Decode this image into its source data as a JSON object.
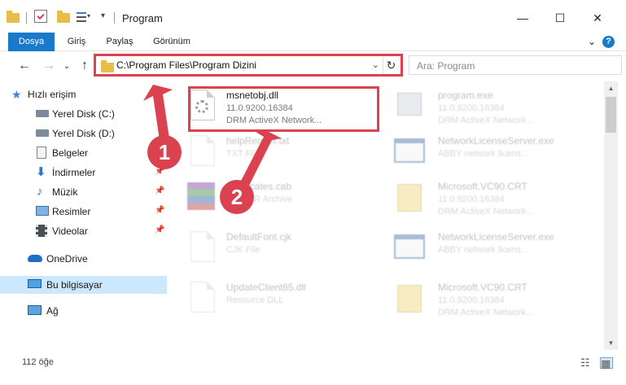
{
  "window": {
    "title": "Program",
    "minimize": "—",
    "maximize": "☐",
    "close": "✕"
  },
  "ribbon": {
    "tabs": [
      "Dosya",
      "Giriş",
      "Paylaş",
      "Görünüm"
    ],
    "expand": "⌄",
    "help": "?"
  },
  "address": {
    "back": "←",
    "forward": "→",
    "recent": "⌄",
    "up": "↑",
    "path": "C:\\Program Files\\Program Dizini",
    "dropdown": "⌄",
    "refresh": "↻",
    "search_placeholder": "Ara: Program"
  },
  "sidebar": {
    "items": [
      {
        "label": "Hızlı erişim",
        "icon": "star-icon",
        "pinned": false
      },
      {
        "label": "Yerel Disk (C:)",
        "icon": "drive-icon",
        "pinned": false
      },
      {
        "label": "Yerel Disk (D:)",
        "icon": "drive-icon",
        "pinned": false
      },
      {
        "label": "Belgeler",
        "icon": "documents-icon",
        "pinned": false
      },
      {
        "label": "İndirmeler",
        "icon": "download-icon",
        "pinned": true
      },
      {
        "label": "Müzik",
        "icon": "music-icon",
        "pinned": true
      },
      {
        "label": "Resimler",
        "icon": "pictures-icon",
        "pinned": true
      },
      {
        "label": "Videolar",
        "icon": "video-icon",
        "pinned": true
      },
      {
        "label": "OneDrive",
        "icon": "cloud-icon",
        "pinned": false
      },
      {
        "label": "Bu bilgisayar",
        "icon": "computer-icon",
        "pinned": false,
        "selected": true
      },
      {
        "label": "Ağ",
        "icon": "network-icon",
        "pinned": false
      }
    ],
    "pin_glyph": "📌"
  },
  "files": [
    {
      "name": "msnetobj.dll",
      "line1": "11.0.9200.16384",
      "line2": "DRM ActiveX Network...",
      "icon": "dll-gear-icon"
    },
    {
      "name": "program.exe",
      "line1": "11.0.9200.16384",
      "line2": "DRM ActiveX Network...",
      "icon": "exe-icon"
    },
    {
      "name": "helpReader.txt",
      "line1": "TXT File",
      "line2": "",
      "icon": "text-file-icon"
    },
    {
      "name": "NetworkLicenseServer.exe",
      "line1": "ABBY network licens...",
      "line2": "",
      "icon": "window-exe-icon"
    },
    {
      "name": "certificates.cab",
      "line1": "WinRAR Archive",
      "line2": "",
      "icon": "winrar-icon"
    },
    {
      "name": "Microsoft.VC90.CRT",
      "line1": "11.0.9200.16384",
      "line2": "DRM ActiveX Network...",
      "icon": "folder-doc-icon"
    },
    {
      "name": "DefaultFont.cjk",
      "line1": "CJK File",
      "line2": "",
      "icon": "blank-file-icon"
    },
    {
      "name": "NetworkLicenseServer.exe",
      "line1": "ABBY network licens...",
      "line2": "",
      "icon": "window-exe-icon"
    },
    {
      "name": "UpdateClient65.dll",
      "line1": "Resource DLL",
      "line2": "",
      "icon": "blank-file-icon"
    },
    {
      "name": "Microsoft.VC90.CRT",
      "line1": "11.0.9200.16384",
      "line2": "DRM ActiveX Network...",
      "icon": "folder-doc-icon"
    }
  ],
  "status": {
    "count": "112 öğe"
  },
  "callouts": {
    "one": "1",
    "two": "2"
  },
  "colors": {
    "accent": "#1979ca",
    "highlight": "#d9424e",
    "selected": "#cce8ff"
  }
}
